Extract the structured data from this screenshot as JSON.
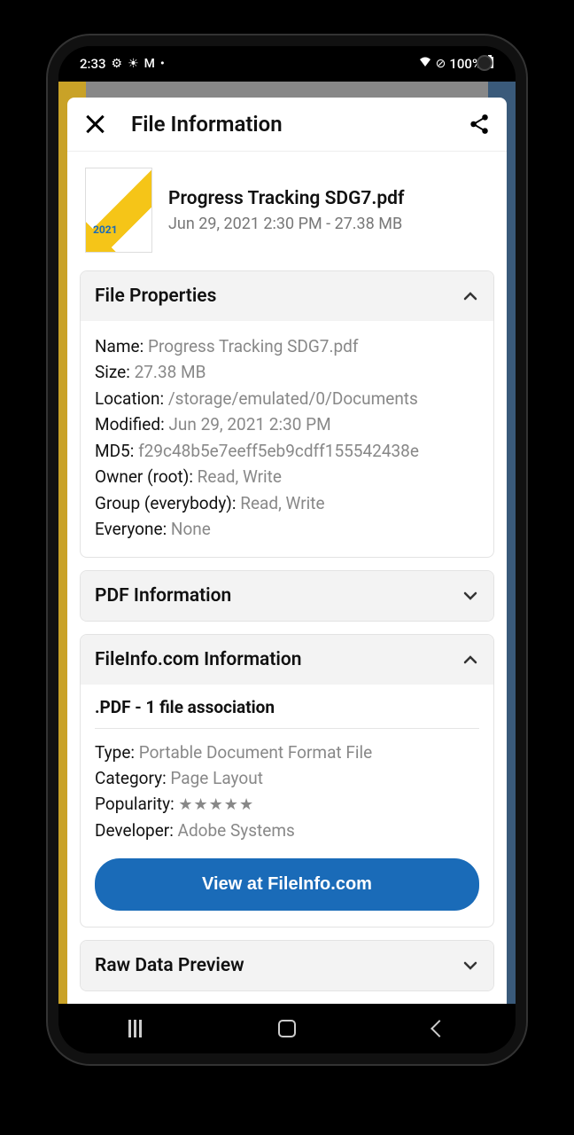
{
  "status": {
    "time": "2:33",
    "battery": "100%"
  },
  "header": {
    "title": "File Information"
  },
  "file": {
    "name": "Progress Tracking SDG7.pdf",
    "sub": "Jun 29, 2021 2:30 PM - 27.38 MB",
    "thumb_year": "2021"
  },
  "properties": {
    "title": "File Properties",
    "name_label": "Name: ",
    "name_value": "Progress Tracking SDG7.pdf",
    "size_label": "Size: ",
    "size_value": "27.38 MB",
    "location_label": "Location: ",
    "location_value": "/storage/emulated/0/Documents",
    "modified_label": "Modified: ",
    "modified_value": "Jun 29, 2021 2:30 PM",
    "md5_label": "MD5: ",
    "md5_value": "f29c48b5e7eeff5eb9cdff155542438e",
    "owner_label": "Owner (root): ",
    "owner_value": "Read, Write",
    "group_label": "Group (everybody): ",
    "group_value": "Read, Write",
    "everyone_label": "Everyone: ",
    "everyone_value": "None"
  },
  "pdf_info": {
    "title": "PDF Information"
  },
  "fileinfo": {
    "title": "FileInfo.com Information",
    "assoc": ".PDF - 1 file association",
    "type_label": "Type: ",
    "type_value": "Portable Document Format File",
    "category_label": "Category: ",
    "category_value": "Page Layout",
    "popularity_label": "Popularity: ",
    "popularity_stars": "★★★★★",
    "developer_label": "Developer: ",
    "developer_value": "Adobe Systems",
    "button": "View at FileInfo.com"
  },
  "rawdata": {
    "title": "Raw Data Preview"
  }
}
